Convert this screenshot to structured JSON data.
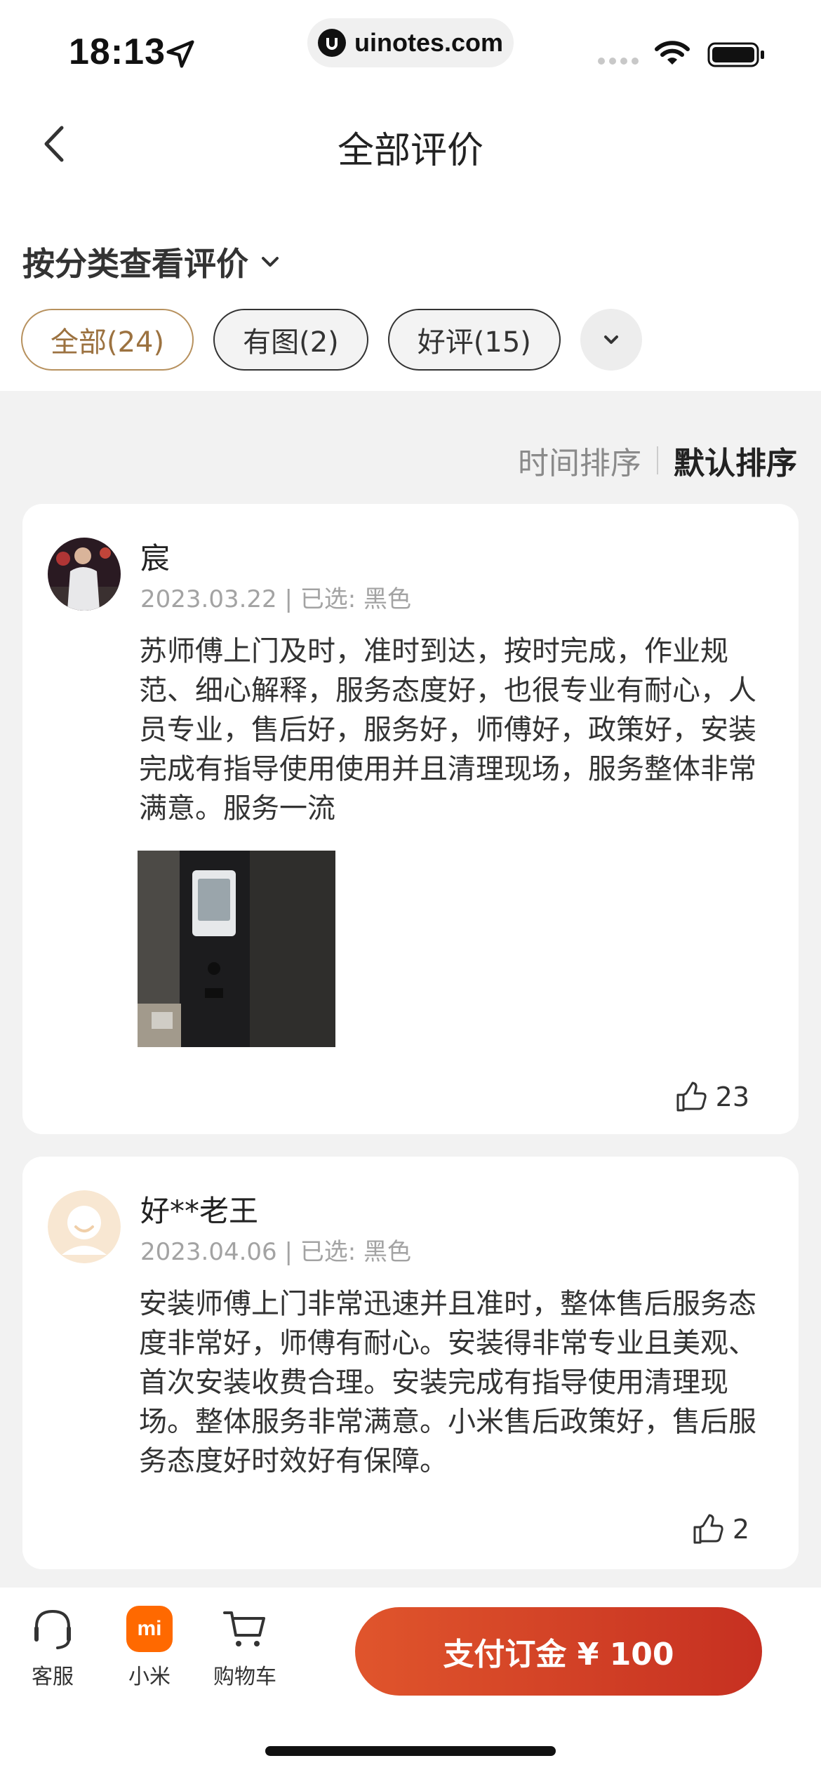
{
  "status_bar": {
    "time": "18:13",
    "url": "uinotes.com"
  },
  "header": {
    "title": "全部评价"
  },
  "filter": {
    "heading": "按分类查看评价",
    "chips": [
      {
        "label": "全部(24)",
        "active": true
      },
      {
        "label": "有图(2)",
        "active": false
      },
      {
        "label": "好评(15)",
        "active": false
      }
    ]
  },
  "sort": {
    "time_label": "时间排序",
    "default_label": "默认排序"
  },
  "reviews": [
    {
      "name": "宸",
      "meta": "2023.03.22 | 已选: 黑色",
      "text": "苏师傅上门及时，准时到达，按时完成，作业规范、细心解释，服务态度好，也很专业有耐心，人员专业，售后好，服务好，师傅好，政策好，安装完成有指导使用使用并且清理现场，服务整体非常满意。服务一流",
      "likes": "23"
    },
    {
      "name": "好**老王",
      "meta": "2023.04.06 | 已选: 黑色",
      "text": "安装师傅上门非常迅速并且准时，整体售后服务态度非常好，师傅有耐心。安装得非常专业且美观、首次安装收费合理。安装完成有指导使用清理现场。整体服务非常满意。小米售后政策好，售后服务态度好时效好有保障。",
      "likes": "2"
    }
  ],
  "bottom_bar": {
    "service_label": "客服",
    "mi_label": "小米",
    "mi_logo_text": "mi",
    "cart_label": "购物车",
    "pay_label": "支付订金 ¥ 100"
  },
  "colors": {
    "accent": "#d9442a",
    "chip_active": "#b7915e",
    "brand": "#ff6900"
  }
}
